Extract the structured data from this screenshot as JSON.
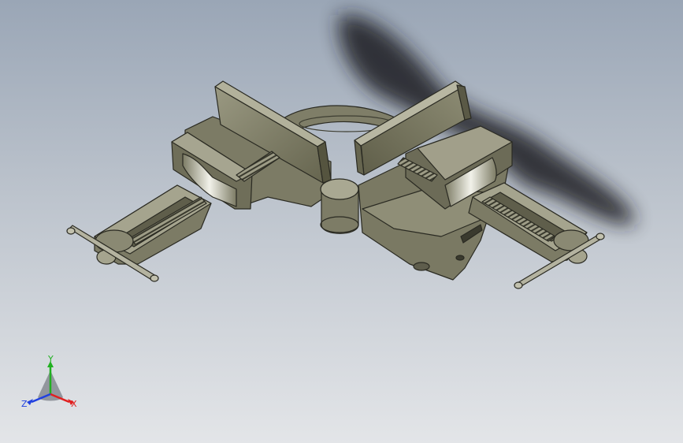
{
  "viewport": {
    "background_top": "#9aa6b6",
    "background_bottom": "#e3e5e8",
    "model_color": "#8b8a72",
    "model_dark": "#5e5d4c",
    "edge_color": "#2a2a22"
  },
  "triad": {
    "x_label": "X",
    "y_label": "Y",
    "z_label": "Z",
    "x_color": "#e02020",
    "y_color": "#20b020",
    "z_color": "#2040e0"
  }
}
